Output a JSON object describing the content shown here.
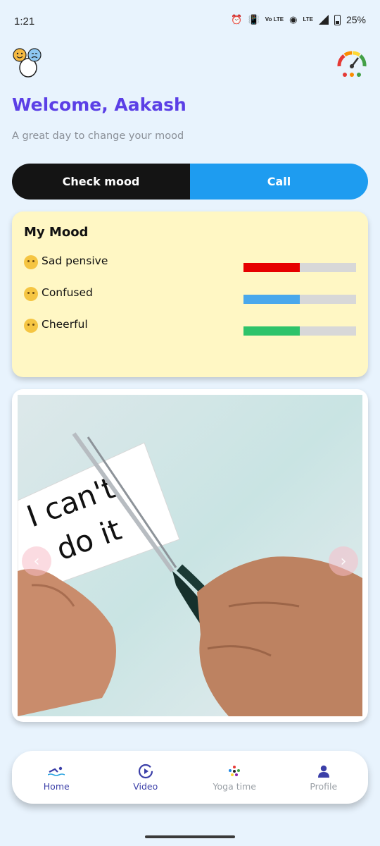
{
  "status": {
    "time": "1:21",
    "battery": "25%",
    "icons": [
      "alarm-icon",
      "vibrate-icon",
      "volte-icon",
      "hotspot-icon",
      "lte-icon",
      "signal-icon",
      "battery-icon"
    ],
    "volte": "Vo LTE",
    "lte": "LTE"
  },
  "header": {
    "welcome": "Welcome, Aakash",
    "subtitle": "A great day to change your mood"
  },
  "actions": {
    "check_mood": "Check mood",
    "call": "Call"
  },
  "mood": {
    "title": "My Mood",
    "items": [
      {
        "emoji": "😔",
        "label": "Sad pensive",
        "level": 0.5,
        "color": "#e60000"
      },
      {
        "emoji": "😕",
        "label": "Confused",
        "level": 0.5,
        "color": "#4aa8ec"
      },
      {
        "emoji": "😘",
        "label": "Cheerful",
        "level": 0.5,
        "color": "#2ec36a"
      }
    ]
  },
  "carousel": {
    "card_text_line1": "I can't",
    "card_text_line2": "do it",
    "prev": "‹",
    "next": "›"
  },
  "nav": {
    "items": [
      {
        "label": "Home",
        "icon": "swimmer-icon",
        "color": "#3b3fa8"
      },
      {
        "label": "Video",
        "icon": "play-circle-icon",
        "color": "#3b3fa8"
      },
      {
        "label": "Yoga time",
        "icon": "yoga-dots-icon",
        "color": "#9aa0a6"
      },
      {
        "label": "Profile",
        "icon": "person-icon",
        "color": "#9aa0a6"
      }
    ]
  },
  "colors": {
    "accent": "#5b3fe6",
    "call_blue": "#1e9cf0",
    "mood_card_bg": "#fff7c4",
    "page_bg": "#e8f3fd"
  }
}
